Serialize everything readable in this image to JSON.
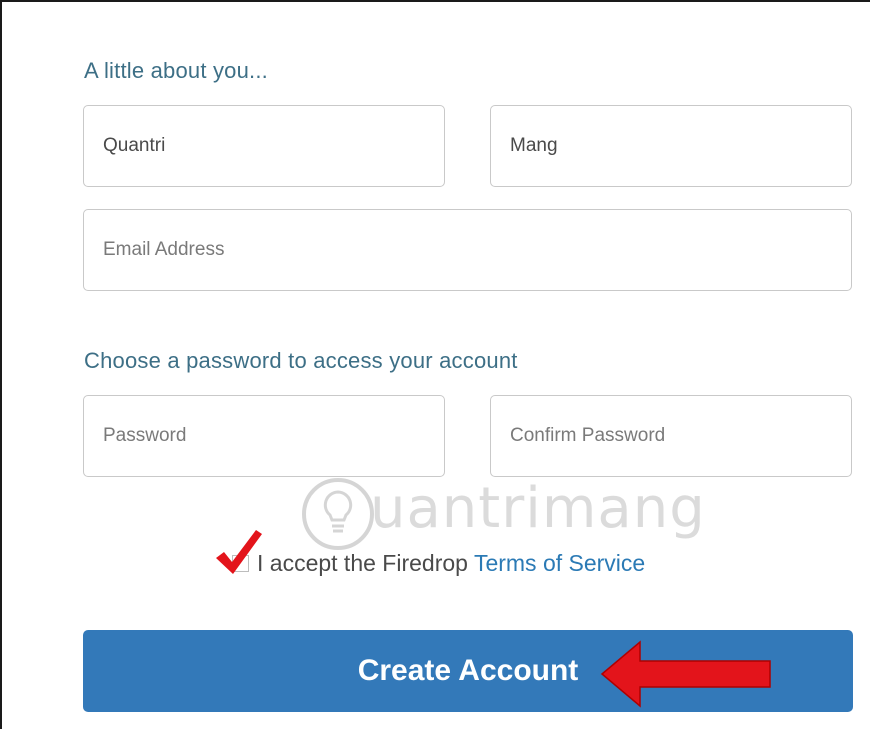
{
  "sections": {
    "about_title": "A little about you...",
    "password_title": "Choose a password to access your account"
  },
  "fields": {
    "first_name_value": "Quantri",
    "last_name_value": "Mang",
    "email_placeholder": "Email Address",
    "password_placeholder": "Password",
    "confirm_password_placeholder": "Confirm Password"
  },
  "terms": {
    "text": "I accept the Firedrop",
    "link": "Terms of Service",
    "checked": true
  },
  "actions": {
    "create_account": "Create Account"
  },
  "watermark": {
    "text": "uantrimang"
  },
  "annotations": {
    "checkmark_icon": "red-checkmark",
    "arrow_icon": "red-left-arrow",
    "accent_red": "#e3141b"
  },
  "colors": {
    "heading": "#3d6f86",
    "button": "#3379b9",
    "link": "#2b7ab5"
  }
}
